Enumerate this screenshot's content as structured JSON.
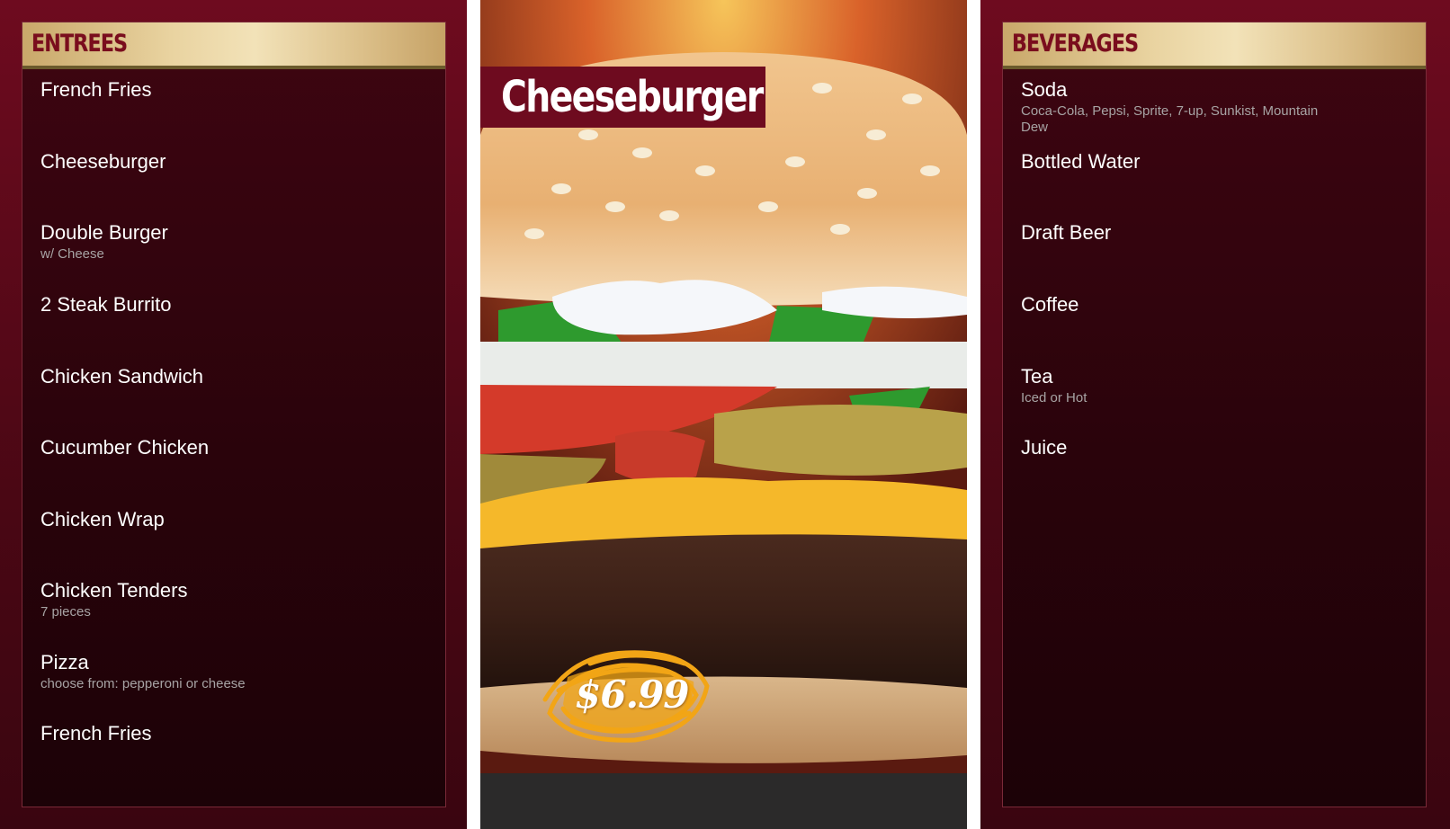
{
  "entrees": {
    "header": "ENTREES",
    "items": [
      {
        "name": "French Fries",
        "desc": ""
      },
      {
        "name": "Cheeseburger",
        "desc": ""
      },
      {
        "name": "Double Burger",
        "desc": "w/ Cheese"
      },
      {
        "name": "2 Steak Burrito",
        "desc": ""
      },
      {
        "name": "Chicken Sandwich",
        "desc": ""
      },
      {
        "name": "Cucumber Chicken",
        "desc": ""
      },
      {
        "name": "Chicken Wrap",
        "desc": ""
      },
      {
        "name": "Chicken Tenders",
        "desc": "7 pieces"
      },
      {
        "name": "Pizza",
        "desc": "choose from: pepperoni or cheese"
      },
      {
        "name": "French Fries",
        "desc": ""
      }
    ]
  },
  "feature": {
    "title": "Cheeseburger",
    "price": "$6.99",
    "image_icon": "cheeseburger-photo",
    "badge_color": "#f2a516"
  },
  "beverages": {
    "header": "BEVERAGES",
    "items": [
      {
        "name": "Soda",
        "desc": "Coca-Cola, Pepsi, Sprite, 7-up, Sunkist, Mountain Dew"
      },
      {
        "name": "Bottled Water",
        "desc": ""
      },
      {
        "name": "Draft Beer",
        "desc": ""
      },
      {
        "name": "Coffee",
        "desc": ""
      },
      {
        "name": "Tea",
        "desc": "Iced or Hot"
      },
      {
        "name": "Juice",
        "desc": ""
      }
    ]
  },
  "colors": {
    "board": "#6e0b1f",
    "panel": "#2a030b",
    "header_text": "#7a0d1d",
    "header_bg": "#e9d3a0"
  }
}
